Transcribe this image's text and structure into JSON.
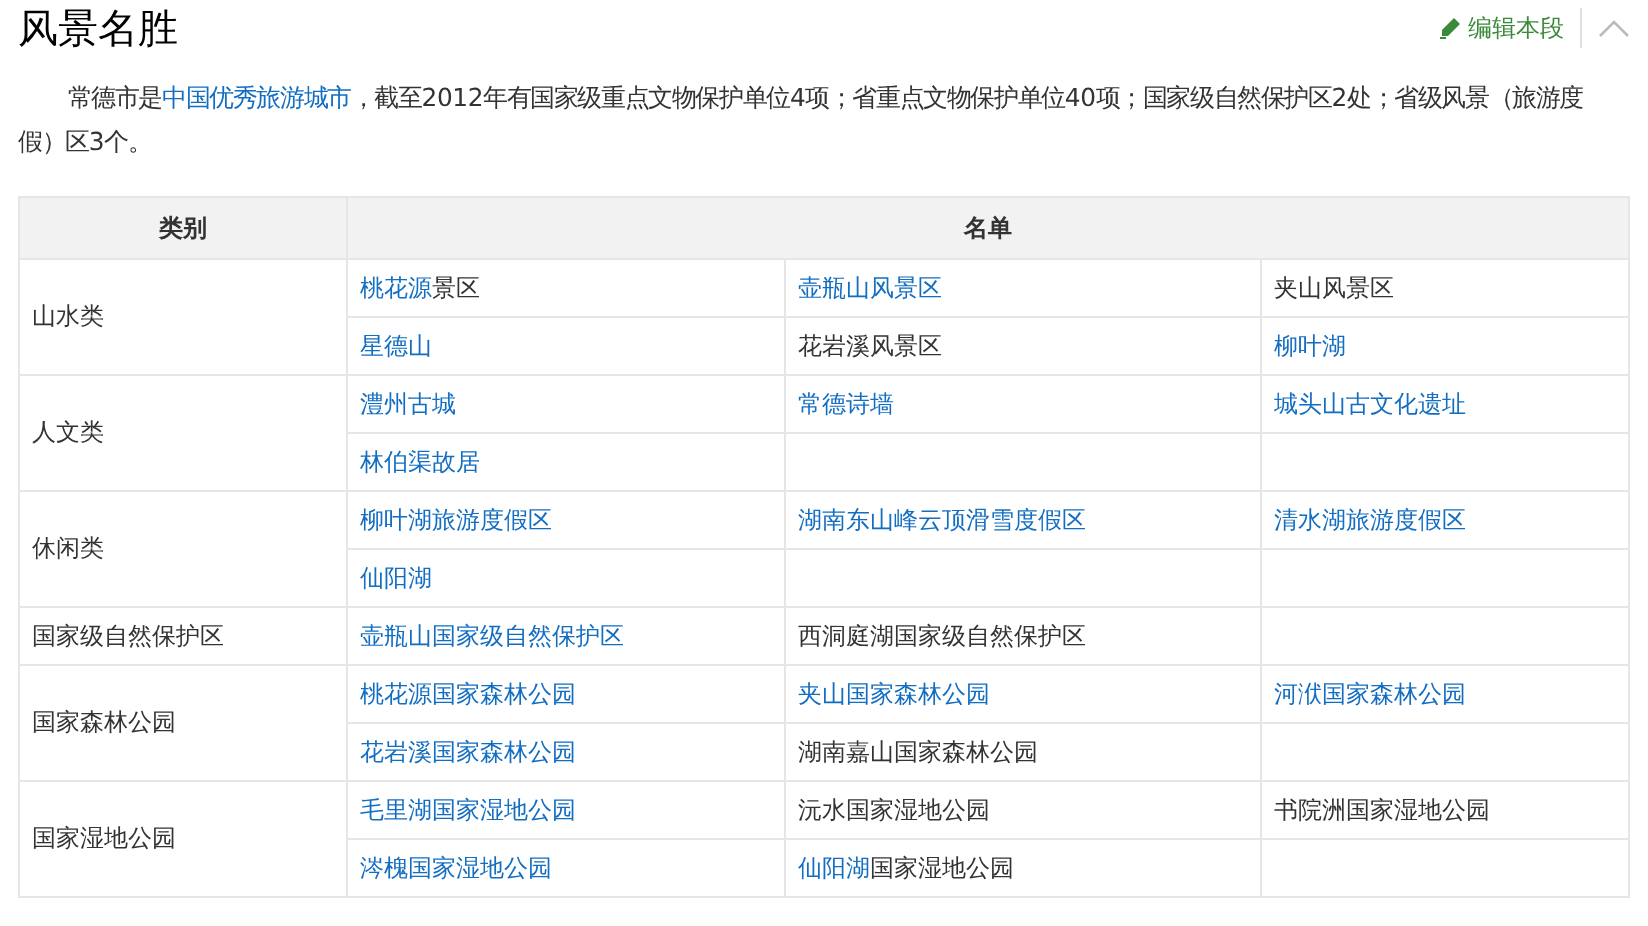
{
  "section": {
    "title": "风景名胜",
    "edit_label": "编辑本段"
  },
  "paragraph": [
    {
      "text": "常德市是",
      "link": false
    },
    {
      "text": "中国优秀旅游城市",
      "link": true
    },
    {
      "text": "，截至2012年有国家级重点文物保护单位4项；省重点文物保护单位40项；国家级自然保护区2处；省级风景（旅游度假）区3个。",
      "link": false
    }
  ],
  "table": {
    "columns": [
      "类别",
      "名单"
    ],
    "groups": [
      {
        "category": "山水类",
        "rows": [
          [
            [
              {
                "text": "桃花源",
                "link": true
              },
              {
                "text": "景区",
                "link": false
              }
            ],
            [
              {
                "text": "壶瓶山风景区",
                "link": true
              }
            ],
            [
              {
                "text": "夹山风景区",
                "link": false
              }
            ]
          ],
          [
            [
              {
                "text": "星德山",
                "link": true
              }
            ],
            [
              {
                "text": "花岩溪风景区",
                "link": false
              }
            ],
            [
              {
                "text": "柳叶湖",
                "link": true
              }
            ]
          ]
        ]
      },
      {
        "category": "人文类",
        "rows": [
          [
            [
              {
                "text": "澧州古城",
                "link": true
              }
            ],
            [
              {
                "text": "常德诗墙",
                "link": true
              }
            ],
            [
              {
                "text": "城头山古文化遗址",
                "link": true
              }
            ]
          ],
          [
            [
              {
                "text": "林伯渠故居",
                "link": true
              }
            ]
          ]
        ]
      },
      {
        "category": "休闲类",
        "rows": [
          [
            [
              {
                "text": "柳叶湖旅游度假区",
                "link": true
              }
            ],
            [
              {
                "text": "湖南东山峰云顶滑雪度假区",
                "link": true
              }
            ],
            [
              {
                "text": "清水湖旅游度假区",
                "link": true
              }
            ]
          ],
          [
            [
              {
                "text": "仙阳湖",
                "link": true
              }
            ]
          ]
        ]
      },
      {
        "category": "国家级自然保护区",
        "rows": [
          [
            [
              {
                "text": "壶瓶山国家级自然保护区",
                "link": true
              }
            ],
            [
              {
                "text": "西洞庭湖国家级自然保护区",
                "link": false
              }
            ]
          ]
        ]
      },
      {
        "category": "国家森林公园",
        "rows": [
          [
            [
              {
                "text": "桃花源国家森林公园",
                "link": true
              }
            ],
            [
              {
                "text": "夹山国家森林公园",
                "link": true
              }
            ],
            [
              {
                "text": "河洑国家森林公园",
                "link": true
              }
            ]
          ],
          [
            [
              {
                "text": "花岩溪国家森林公园",
                "link": true
              }
            ],
            [
              {
                "text": "湖南嘉山国家森林公园",
                "link": false
              }
            ]
          ]
        ]
      },
      {
        "category": "国家湿地公园",
        "rows": [
          [
            [
              {
                "text": "毛里湖国家湿地公园",
                "link": true
              }
            ],
            [
              {
                "text": "沅水国家湿地公园",
                "link": false
              }
            ],
            [
              {
                "text": "书院洲国家湿地公园",
                "link": false
              }
            ]
          ],
          [
            [
              {
                "text": "涔槐国家湿地公园",
                "link": true
              }
            ],
            [
              {
                "text": "仙阳湖",
                "link": true
              },
              {
                "text": "国家湿地公园",
                "link": false
              }
            ]
          ]
        ]
      }
    ]
  }
}
